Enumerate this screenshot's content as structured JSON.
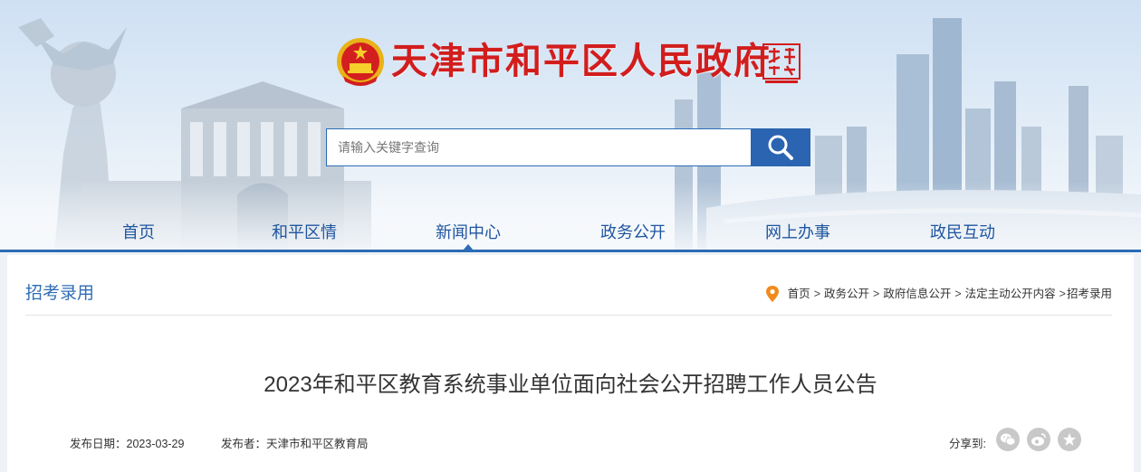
{
  "header": {
    "site_title": "天津市和平区人民政府",
    "seal_text": "天津 TIANJIN CHINA",
    "search": {
      "placeholder": "请输入关键字查询"
    },
    "colors": {
      "title_red": "#d21d1d",
      "brand_blue": "#2b64b0",
      "nav_text": "#1f56a0"
    }
  },
  "nav": {
    "items": [
      {
        "label": "首页"
      },
      {
        "label": "和平区情"
      },
      {
        "label": "新闻中心"
      },
      {
        "label": "政务公开"
      },
      {
        "label": "网上办事"
      },
      {
        "label": "政民互动"
      }
    ],
    "active_index": 2
  },
  "page": {
    "section_title": "招考录用",
    "breadcrumb": [
      "首页",
      "政务公开",
      "政府信息公开",
      "法定主动公开内容",
      "招考录用"
    ],
    "breadcrumb_separator": ">",
    "article": {
      "title": "2023年和平区教育系统事业单位面向社会公开招聘工作人员公告",
      "date_label": "发布日期：",
      "date": "2023-03-29",
      "publisher_label": "发布者：",
      "publisher": "天津市和平区教育局"
    },
    "share": {
      "label": "分享到:",
      "icons": [
        "wechat-icon",
        "weibo-icon",
        "favorite-icon"
      ]
    }
  }
}
